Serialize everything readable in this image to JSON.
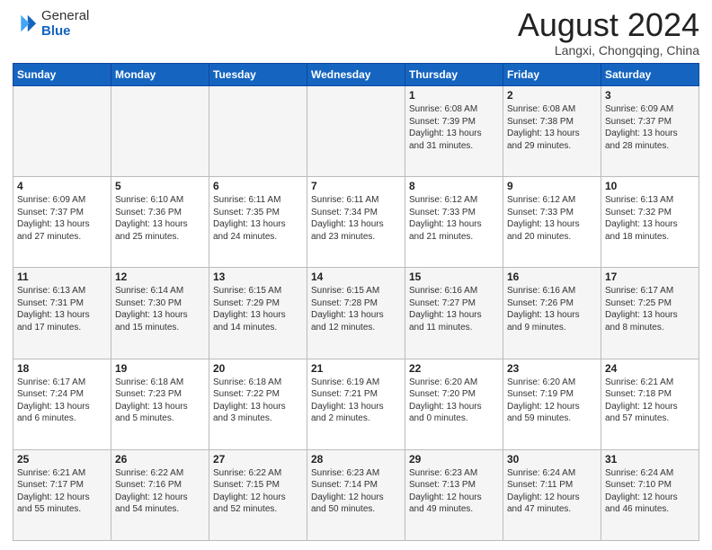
{
  "logo": {
    "general": "General",
    "blue": "Blue"
  },
  "title": {
    "month_year": "August 2024",
    "location": "Langxi, Chongqing, China"
  },
  "weekdays": [
    "Sunday",
    "Monday",
    "Tuesday",
    "Wednesday",
    "Thursday",
    "Friday",
    "Saturday"
  ],
  "weeks": [
    [
      {
        "day": "",
        "info": ""
      },
      {
        "day": "",
        "info": ""
      },
      {
        "day": "",
        "info": ""
      },
      {
        "day": "",
        "info": ""
      },
      {
        "day": "1",
        "info": "Sunrise: 6:08 AM\nSunset: 7:39 PM\nDaylight: 13 hours and 31 minutes."
      },
      {
        "day": "2",
        "info": "Sunrise: 6:08 AM\nSunset: 7:38 PM\nDaylight: 13 hours and 29 minutes."
      },
      {
        "day": "3",
        "info": "Sunrise: 6:09 AM\nSunset: 7:37 PM\nDaylight: 13 hours and 28 minutes."
      }
    ],
    [
      {
        "day": "4",
        "info": "Sunrise: 6:09 AM\nSunset: 7:37 PM\nDaylight: 13 hours and 27 minutes."
      },
      {
        "day": "5",
        "info": "Sunrise: 6:10 AM\nSunset: 7:36 PM\nDaylight: 13 hours and 25 minutes."
      },
      {
        "day": "6",
        "info": "Sunrise: 6:11 AM\nSunset: 7:35 PM\nDaylight: 13 hours and 24 minutes."
      },
      {
        "day": "7",
        "info": "Sunrise: 6:11 AM\nSunset: 7:34 PM\nDaylight: 13 hours and 23 minutes."
      },
      {
        "day": "8",
        "info": "Sunrise: 6:12 AM\nSunset: 7:33 PM\nDaylight: 13 hours and 21 minutes."
      },
      {
        "day": "9",
        "info": "Sunrise: 6:12 AM\nSunset: 7:33 PM\nDaylight: 13 hours and 20 minutes."
      },
      {
        "day": "10",
        "info": "Sunrise: 6:13 AM\nSunset: 7:32 PM\nDaylight: 13 hours and 18 minutes."
      }
    ],
    [
      {
        "day": "11",
        "info": "Sunrise: 6:13 AM\nSunset: 7:31 PM\nDaylight: 13 hours and 17 minutes."
      },
      {
        "day": "12",
        "info": "Sunrise: 6:14 AM\nSunset: 7:30 PM\nDaylight: 13 hours and 15 minutes."
      },
      {
        "day": "13",
        "info": "Sunrise: 6:15 AM\nSunset: 7:29 PM\nDaylight: 13 hours and 14 minutes."
      },
      {
        "day": "14",
        "info": "Sunrise: 6:15 AM\nSunset: 7:28 PM\nDaylight: 13 hours and 12 minutes."
      },
      {
        "day": "15",
        "info": "Sunrise: 6:16 AM\nSunset: 7:27 PM\nDaylight: 13 hours and 11 minutes."
      },
      {
        "day": "16",
        "info": "Sunrise: 6:16 AM\nSunset: 7:26 PM\nDaylight: 13 hours and 9 minutes."
      },
      {
        "day": "17",
        "info": "Sunrise: 6:17 AM\nSunset: 7:25 PM\nDaylight: 13 hours and 8 minutes."
      }
    ],
    [
      {
        "day": "18",
        "info": "Sunrise: 6:17 AM\nSunset: 7:24 PM\nDaylight: 13 hours and 6 minutes."
      },
      {
        "day": "19",
        "info": "Sunrise: 6:18 AM\nSunset: 7:23 PM\nDaylight: 13 hours and 5 minutes."
      },
      {
        "day": "20",
        "info": "Sunrise: 6:18 AM\nSunset: 7:22 PM\nDaylight: 13 hours and 3 minutes."
      },
      {
        "day": "21",
        "info": "Sunrise: 6:19 AM\nSunset: 7:21 PM\nDaylight: 13 hours and 2 minutes."
      },
      {
        "day": "22",
        "info": "Sunrise: 6:20 AM\nSunset: 7:20 PM\nDaylight: 13 hours and 0 minutes."
      },
      {
        "day": "23",
        "info": "Sunrise: 6:20 AM\nSunset: 7:19 PM\nDaylight: 12 hours and 59 minutes."
      },
      {
        "day": "24",
        "info": "Sunrise: 6:21 AM\nSunset: 7:18 PM\nDaylight: 12 hours and 57 minutes."
      }
    ],
    [
      {
        "day": "25",
        "info": "Sunrise: 6:21 AM\nSunset: 7:17 PM\nDaylight: 12 hours and 55 minutes."
      },
      {
        "day": "26",
        "info": "Sunrise: 6:22 AM\nSunset: 7:16 PM\nDaylight: 12 hours and 54 minutes."
      },
      {
        "day": "27",
        "info": "Sunrise: 6:22 AM\nSunset: 7:15 PM\nDaylight: 12 hours and 52 minutes."
      },
      {
        "day": "28",
        "info": "Sunrise: 6:23 AM\nSunset: 7:14 PM\nDaylight: 12 hours and 50 minutes."
      },
      {
        "day": "29",
        "info": "Sunrise: 6:23 AM\nSunset: 7:13 PM\nDaylight: 12 hours and 49 minutes."
      },
      {
        "day": "30",
        "info": "Sunrise: 6:24 AM\nSunset: 7:11 PM\nDaylight: 12 hours and 47 minutes."
      },
      {
        "day": "31",
        "info": "Sunrise: 6:24 AM\nSunset: 7:10 PM\nDaylight: 12 hours and 46 minutes."
      }
    ]
  ]
}
